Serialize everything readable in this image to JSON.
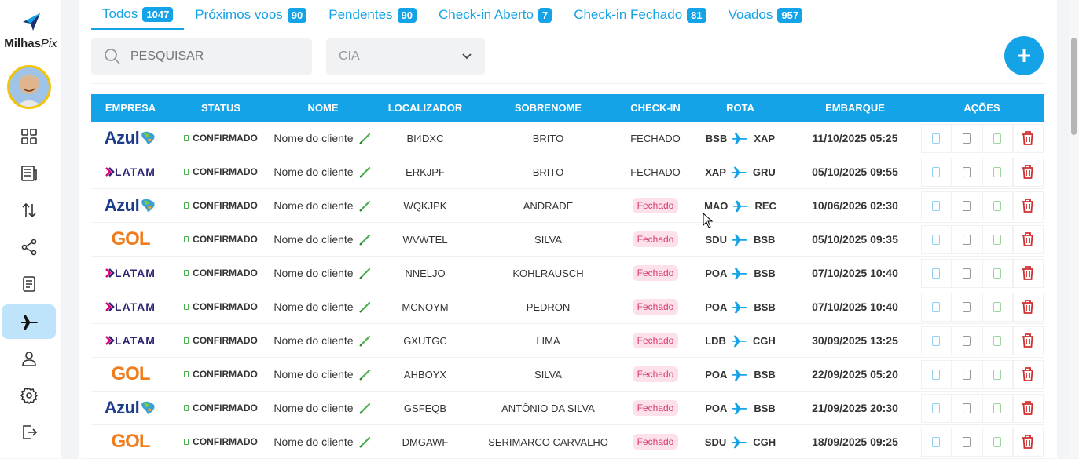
{
  "app": {
    "logo_main": "Milhas",
    "logo_accent": "Pix"
  },
  "sidebar": {
    "items": [
      {
        "name": "dashboard-icon"
      },
      {
        "name": "news-icon"
      },
      {
        "name": "transfer-icon"
      },
      {
        "name": "share-icon"
      },
      {
        "name": "document-icon"
      },
      {
        "name": "airplane-icon",
        "active": true
      },
      {
        "name": "user-icon"
      },
      {
        "name": "settings-icon"
      },
      {
        "name": "logout-icon"
      }
    ]
  },
  "tabs": [
    {
      "label": "Todos",
      "count": "1047",
      "active": true
    },
    {
      "label": "Próximos voos",
      "count": "90"
    },
    {
      "label": "Pendentes",
      "count": "90"
    },
    {
      "label": "Check-in Aberto",
      "count": "7"
    },
    {
      "label": "Check-in Fechado",
      "count": "81"
    },
    {
      "label": "Voados",
      "count": "957"
    }
  ],
  "filters": {
    "search_placeholder": "PESQUISAR",
    "cia_placeholder": "CIA"
  },
  "table": {
    "headers": [
      "EMPRESA",
      "STATUS",
      "NOME",
      "LOCALIZADOR",
      "SOBRENOME",
      "CHECK-IN",
      "ROTA",
      "EMBARQUE",
      "AÇÕES"
    ],
    "rows": [
      {
        "airline": "Azul",
        "status": "CONFIRMADO",
        "nome": "Nome do cliente",
        "localizador": "BI4DXC",
        "sobrenome": "BRITO",
        "checkin": "FECHADO",
        "checkin_pill": false,
        "from": "BSB",
        "to": "XAP",
        "embarque": "11/10/2025 05:25"
      },
      {
        "airline": "LATAM",
        "status": "CONFIRMADO",
        "nome": "Nome do cliente",
        "localizador": "ERKJPF",
        "sobrenome": "BRITO",
        "checkin": "FECHADO",
        "checkin_pill": false,
        "from": "XAP",
        "to": "GRU",
        "embarque": "05/10/2025 09:55"
      },
      {
        "airline": "Azul",
        "status": "CONFIRMADO",
        "nome": "Nome do cliente",
        "localizador": "WQKJPK",
        "sobrenome": "ANDRADE",
        "checkin": "Fechado",
        "checkin_pill": true,
        "from": "MAO",
        "to": "REC",
        "embarque": "10/06/2026 02:30"
      },
      {
        "airline": "GOL",
        "status": "CONFIRMADO",
        "nome": "Nome do cliente",
        "localizador": "WVWTEL",
        "sobrenome": "SILVA",
        "checkin": "Fechado",
        "checkin_pill": true,
        "from": "SDU",
        "to": "BSB",
        "embarque": "05/10/2025 09:35"
      },
      {
        "airline": "LATAM",
        "status": "CONFIRMADO",
        "nome": "Nome do cliente",
        "localizador": "NNELJO",
        "sobrenome": "KOHLRAUSCH",
        "checkin": "Fechado",
        "checkin_pill": true,
        "from": "POA",
        "to": "BSB",
        "embarque": "07/10/2025 10:40"
      },
      {
        "airline": "LATAM",
        "status": "CONFIRMADO",
        "nome": "Nome do cliente",
        "localizador": "MCNOYM",
        "sobrenome": "PEDRON",
        "checkin": "Fechado",
        "checkin_pill": true,
        "from": "POA",
        "to": "BSB",
        "embarque": "07/10/2025 10:40"
      },
      {
        "airline": "LATAM",
        "status": "CONFIRMADO",
        "nome": "Nome do cliente",
        "localizador": "GXUTGC",
        "sobrenome": "LIMA",
        "checkin": "Fechado",
        "checkin_pill": true,
        "from": "LDB",
        "to": "CGH",
        "embarque": "30/09/2025 13:25"
      },
      {
        "airline": "GOL",
        "status": "CONFIRMADO",
        "nome": "Nome do cliente",
        "localizador": "AHBOYX",
        "sobrenome": "SILVA",
        "checkin": "Fechado",
        "checkin_pill": true,
        "from": "POA",
        "to": "BSB",
        "embarque": "22/09/2025 05:20"
      },
      {
        "airline": "Azul",
        "status": "CONFIRMADO",
        "nome": "Nome do cliente",
        "localizador": "GSFEQB",
        "sobrenome": "ANTÔNIO DA SILVA",
        "checkin": "Fechado",
        "checkin_pill": true,
        "from": "POA",
        "to": "BSB",
        "embarque": "21/09/2025 20:30"
      },
      {
        "airline": "GOL",
        "status": "CONFIRMADO",
        "nome": "Nome do cliente",
        "localizador": "DMGAWF",
        "sobrenome": "SERIMARCO CARVALHO",
        "checkin": "Fechado",
        "checkin_pill": true,
        "from": "SDU",
        "to": "CGH",
        "embarque": "18/09/2025 09:25"
      }
    ]
  },
  "colors": {
    "accent": "#14a3e6",
    "pill_bg": "#fde1ea",
    "pill_text": "#d63a6a",
    "delete": "#d32f2f"
  }
}
